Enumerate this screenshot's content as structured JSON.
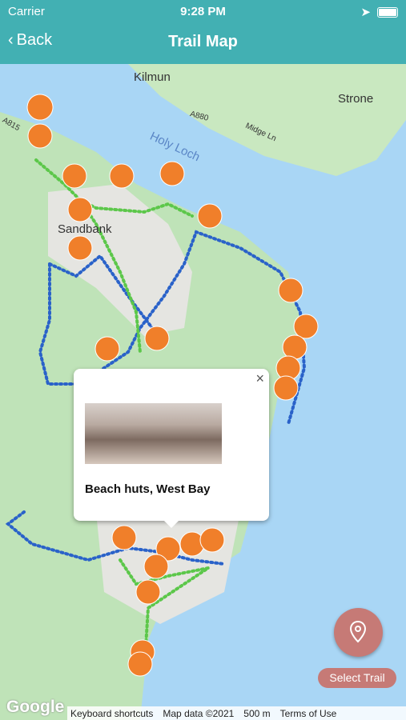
{
  "status_bar": {
    "carrier": "Carrier",
    "time": "9:28 PM"
  },
  "nav": {
    "back_label": "Back",
    "title": "Trail Map"
  },
  "map": {
    "place_labels": {
      "kilmun": "Kilmun",
      "strone": "Strone",
      "holy_loch": "Holy Loch",
      "sandbank": "Sandbank",
      "a815": "A815",
      "a880": "A880",
      "midge_ln": "Midge Ln"
    },
    "popup": {
      "title": "Beach huts, West Bay",
      "close_symbol": "×"
    },
    "attribution": {
      "google": "Google",
      "keyboard": "Keyboard shortcuts",
      "map_data": "Map data ©2021",
      "scale": "500 m",
      "terms": "Terms of Use"
    }
  },
  "select_trail_label": "Select Trail",
  "colors": {
    "header": "#42b0b3",
    "pin": "#f07f2a",
    "trail_blue": "#2a62c9",
    "trail_green": "#5cc74a",
    "fab": "#c67a76"
  }
}
